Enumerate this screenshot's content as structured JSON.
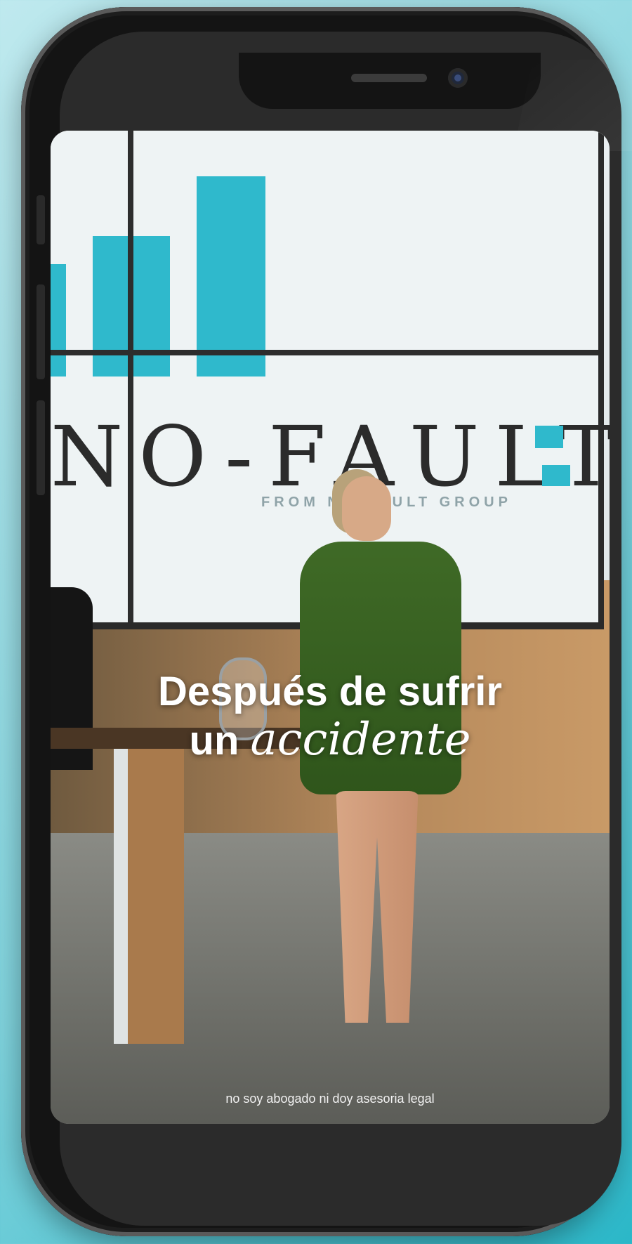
{
  "video": {
    "caption_line1": "Después de sufrir",
    "caption_line2_word1": "un",
    "caption_line2_word2": "accidente",
    "disclaimer": "no soy abogado ni doy asesoria legal"
  },
  "scene": {
    "logo_text": "NO-FAULT",
    "logo_subtext": "FROM NO-FAULT GROUP"
  },
  "colors": {
    "background_accent": "#2bb7c8",
    "logo_accent": "#2fb9cc",
    "phone_frame": "#141414"
  }
}
